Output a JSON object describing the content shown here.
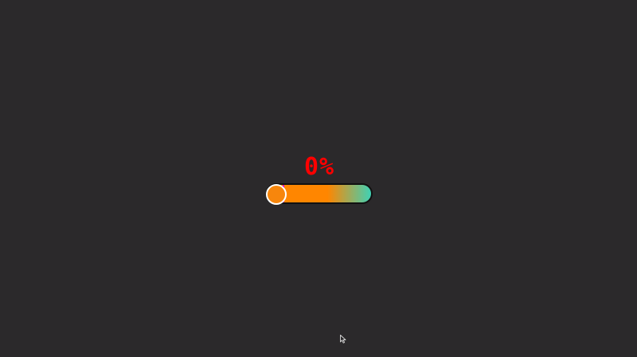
{
  "progress": {
    "value_label": "0%",
    "value_percent": 0
  },
  "colors": {
    "background": "#2b292b",
    "value_text": "#ff0000",
    "track_start": "#ff8600",
    "track_end": "#3fd1b5",
    "thumb_fill": "#f7860c",
    "thumb_border": "#ffffff",
    "thumb_marker": "#d400d4"
  },
  "icons": {
    "cursor": "arrow-cursor-icon"
  }
}
